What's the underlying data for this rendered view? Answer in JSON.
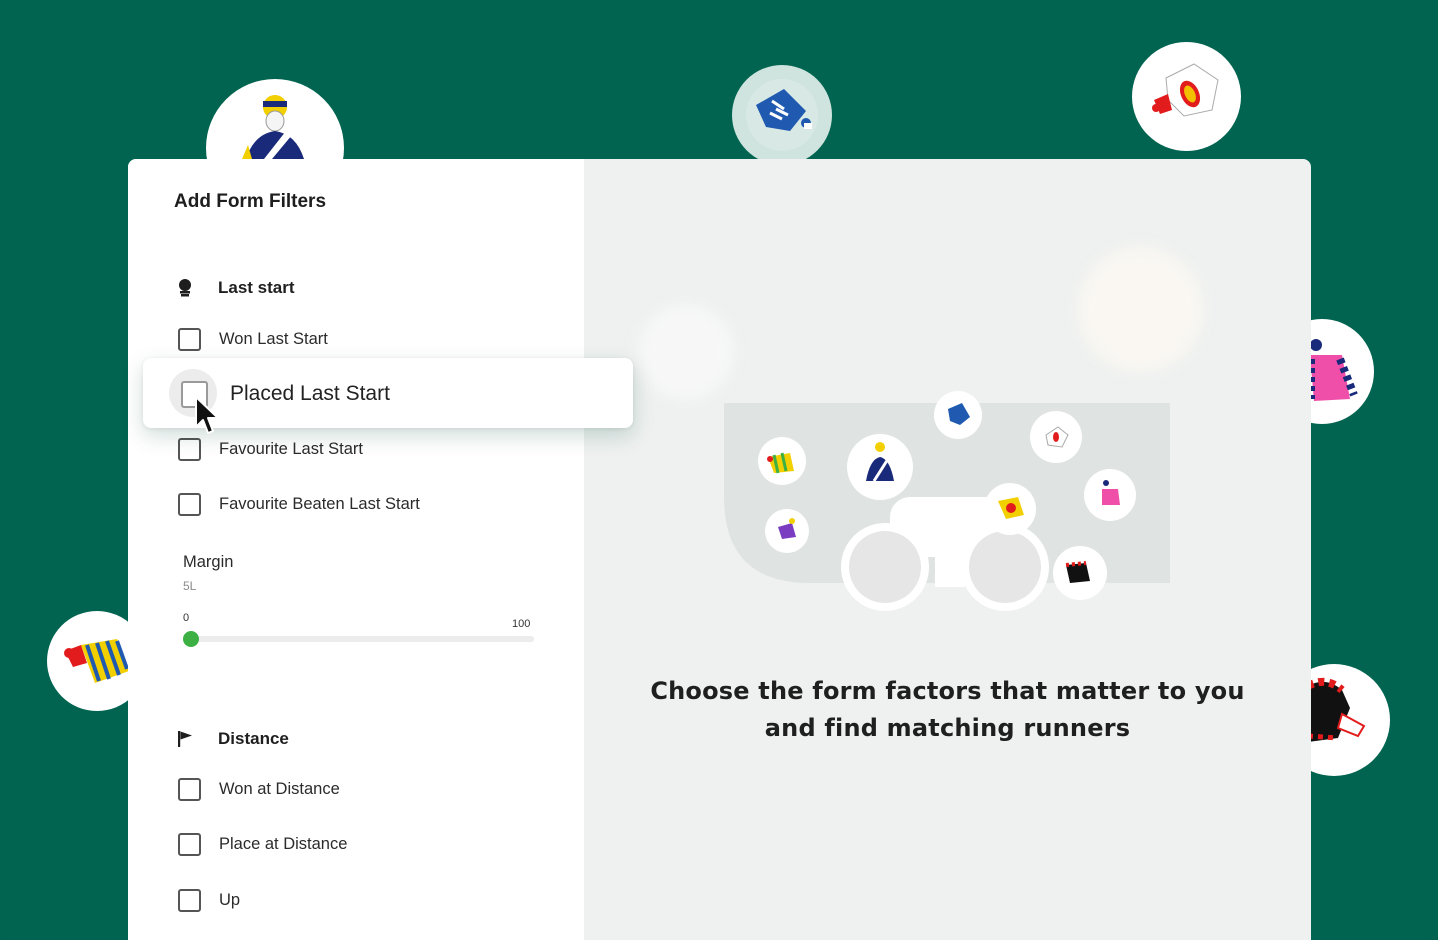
{
  "panel": {
    "title": "Add Form Filters"
  },
  "sections": {
    "last_start": {
      "heading": "Last start",
      "icon": "jockey-cap-icon",
      "options": [
        "Won Last Start",
        "Placed Last Start",
        "Favourite Last Start",
        "Favourite Beaten Last Start"
      ]
    },
    "margin": {
      "label": "Margin",
      "value": "5L",
      "min": "0",
      "max": "100",
      "level": 0
    },
    "distance": {
      "heading": "Distance",
      "icon": "flag-icon",
      "options": [
        "Won at Distance",
        "Place at Distance",
        "Up"
      ]
    }
  },
  "empty_state": {
    "line1": "Choose the form factors that matter to you",
    "line2": "and find matching runners",
    "illustration": "binoculars-icon"
  },
  "colors": {
    "brand_green": "#016450",
    "slider_thumb": "#3cb043",
    "panel_bg": "#eef1f0"
  }
}
